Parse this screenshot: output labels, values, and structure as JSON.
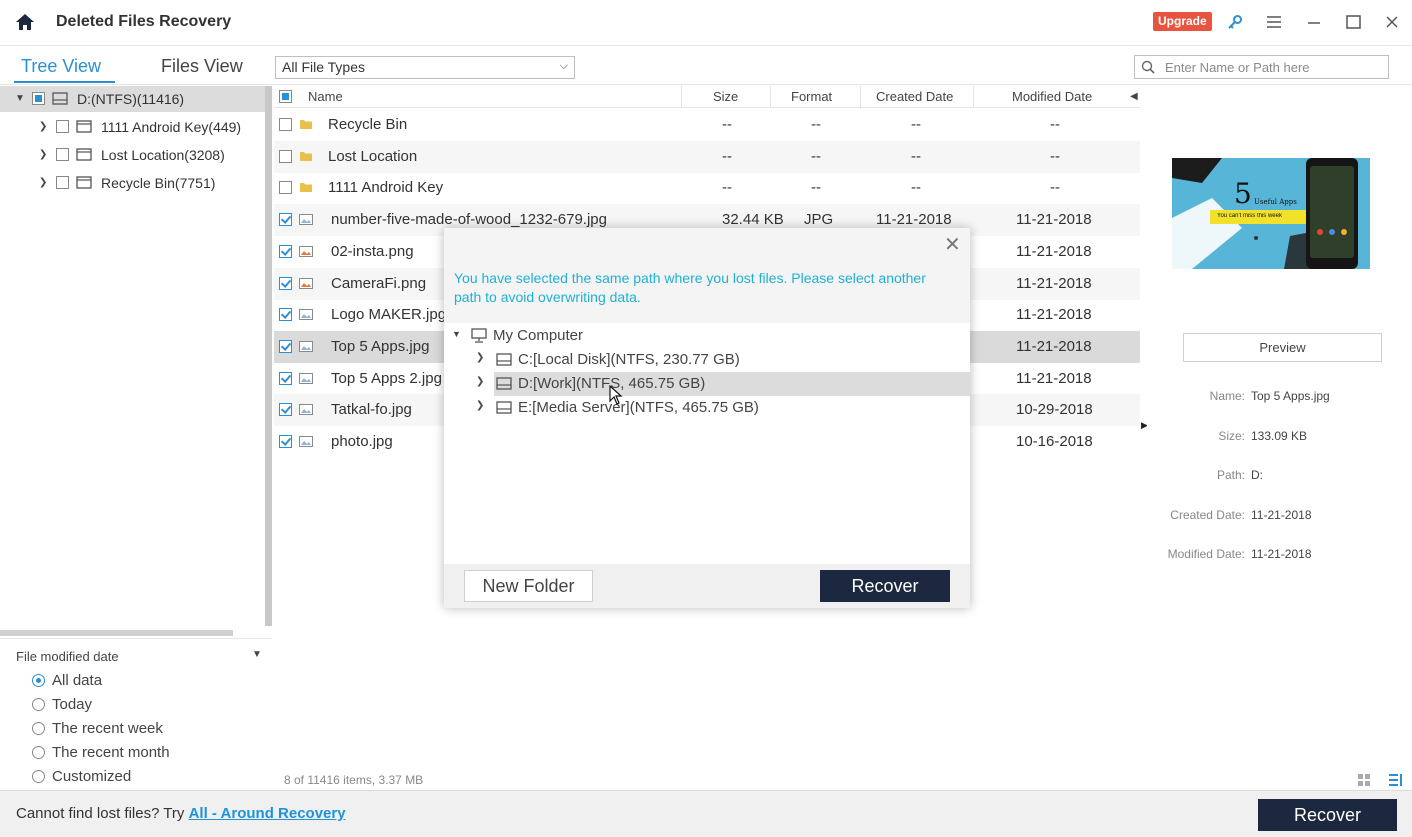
{
  "app": {
    "title": "Deleted Files Recovery",
    "upgrade_label": "Upgrade"
  },
  "tabs": {
    "tree_view": "Tree View",
    "files_view": "Files View"
  },
  "filter_select": {
    "value": "All File Types"
  },
  "search": {
    "placeholder": "Enter Name or Path here"
  },
  "tree": {
    "root": {
      "label": "D:(NTFS)(11416)"
    },
    "children": [
      {
        "label": "1111   Android Key(449)"
      },
      {
        "label": "Lost Location(3208)"
      },
      {
        "label": "Recycle Bin(7751)"
      }
    ]
  },
  "date_filter": {
    "title": "File modified date",
    "options": [
      "All data",
      "Today",
      "The recent week",
      "The recent month",
      "Customized"
    ],
    "selected": "All data"
  },
  "table": {
    "columns": {
      "name": "Name",
      "size": "Size",
      "format": "Format",
      "created": "Created Date",
      "modified": "Modified Date"
    },
    "rows": [
      {
        "name": "Recycle Bin",
        "size": "--",
        "format": "--",
        "created": "--",
        "modified": "--",
        "type": "folder",
        "checked": false
      },
      {
        "name": "Lost Location",
        "size": "--",
        "format": "--",
        "created": "--",
        "modified": "--",
        "type": "folder",
        "checked": false
      },
      {
        "name": "1111   Android Key",
        "size": "--",
        "format": "--",
        "created": "--",
        "modified": "--",
        "type": "folder",
        "checked": false
      },
      {
        "name": "number-five-made-of-wood_1232-679.jpg",
        "size": "32.44 KB",
        "format": "JPG",
        "created": "11-21-2018",
        "modified": "11-21-2018",
        "type": "image",
        "checked": true
      },
      {
        "name": "02-insta.png",
        "size": "",
        "format": "",
        "created": "",
        "modified": "11-21-2018",
        "type": "image-color",
        "checked": true
      },
      {
        "name": "CameraFi.png",
        "size": "",
        "format": "",
        "created": "",
        "modified": "11-21-2018",
        "type": "image-color",
        "checked": true
      },
      {
        "name": "Logo MAKER.jpg",
        "size": "",
        "format": "",
        "created": "",
        "modified": "11-21-2018",
        "type": "image",
        "checked": true
      },
      {
        "name": "Top 5 Apps.jpg",
        "size": "",
        "format": "",
        "created": "",
        "modified": "11-21-2018",
        "type": "image",
        "checked": true
      },
      {
        "name": "Top 5 Apps 2.jpg",
        "size": "",
        "format": "",
        "created": "",
        "modified": "11-21-2018",
        "type": "image",
        "checked": true
      },
      {
        "name": "Tatkal-fo.jpg",
        "size": "",
        "format": "",
        "created": "",
        "modified": "10-29-2018",
        "type": "image",
        "checked": true
      },
      {
        "name": "photo.jpg",
        "size": "",
        "format": "",
        "created": "",
        "modified": "10-16-2018",
        "type": "image",
        "checked": true
      }
    ],
    "selected_index": 7,
    "status": "8 of 11416 items, 3.37 MB"
  },
  "preview": {
    "button_label": "Preview",
    "thumb_big_text": "5",
    "thumb_small_text": "Useful Apps",
    "thumb_tagline": "You can't miss this week",
    "info": [
      {
        "label": "Name:",
        "value": "Top 5 Apps.jpg"
      },
      {
        "label": "Size:",
        "value": "133.09 KB"
      },
      {
        "label": "Path:",
        "value": "D:"
      },
      {
        "label": "Created Date:",
        "value": "11-21-2018"
      },
      {
        "label": "Modified Date:",
        "value": "11-21-2018"
      }
    ]
  },
  "dialog": {
    "message": "You have selected the same path where you lost files. Please select another path to avoid overwriting data.",
    "root": "My Computer",
    "drives": [
      "C:[Local Disk](NTFS, 230.77 GB)",
      "D:[Work](NTFS, 465.75 GB)",
      "E:[Media Server](NTFS, 465.75 GB)"
    ],
    "highlighted_drive": 1,
    "new_folder_label": "New Folder",
    "recover_label": "Recover"
  },
  "bottom": {
    "prompt": "Cannot find lost files? Try ",
    "link": "All - Around Recovery",
    "recover_label": "Recover"
  },
  "colors": {
    "accent": "#2b8fd6",
    "dark_button": "#1c2740",
    "upgrade": "#e8543f",
    "dialog_message": "#1fb1d4"
  }
}
